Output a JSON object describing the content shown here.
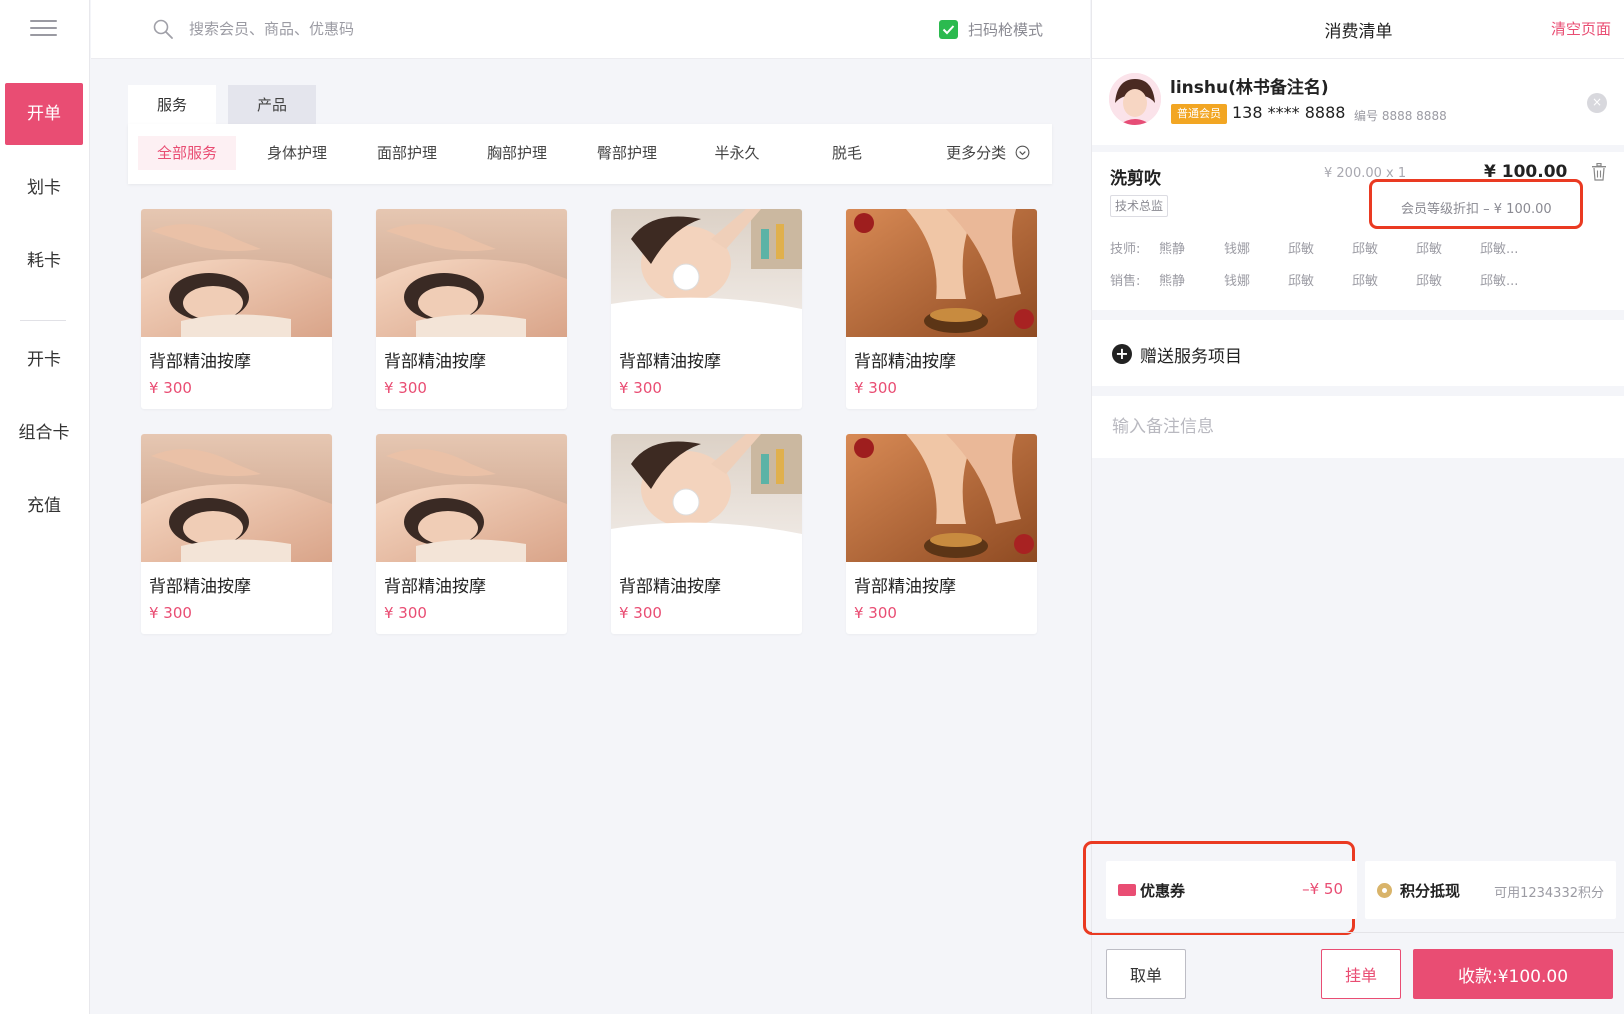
{
  "sidebar": {
    "items": [
      {
        "label": "开单",
        "active": true
      },
      {
        "label": "划卡"
      },
      {
        "label": "耗卡"
      },
      {
        "label": "开卡"
      },
      {
        "label": "组合卡"
      },
      {
        "label": "充值"
      }
    ]
  },
  "search": {
    "placeholder": "搜索会员、商品、优惠码",
    "scan_mode_label": "扫码枪模式",
    "scan_mode_checked": true
  },
  "tabs": [
    {
      "label": "服务",
      "active": true
    },
    {
      "label": "产品"
    }
  ],
  "categories": [
    {
      "label": "全部服务",
      "active": true
    },
    {
      "label": "身体护理"
    },
    {
      "label": "面部护理"
    },
    {
      "label": "胸部护理"
    },
    {
      "label": "臀部护理"
    },
    {
      "label": "半永久"
    },
    {
      "label": "脱毛"
    },
    {
      "label": "更多分类"
    }
  ],
  "products": [
    {
      "name": "背部精油按摩",
      "price": "¥ 300",
      "image": "back-massage"
    },
    {
      "name": "背部精油按摩",
      "price": "¥ 300",
      "image": "back-massage"
    },
    {
      "name": "背部精油按摩",
      "price": "¥ 300",
      "image": "facial-care"
    },
    {
      "name": "背部精油按摩",
      "price": "¥ 300",
      "image": "oil-massage"
    },
    {
      "name": "背部精油按摩",
      "price": "¥ 300",
      "image": "back-massage"
    },
    {
      "name": "背部精油按摩",
      "price": "¥ 300",
      "image": "back-massage"
    },
    {
      "name": "背部精油按摩",
      "price": "¥ 300",
      "image": "facial-care"
    },
    {
      "name": "背部精油按摩",
      "price": "¥ 300",
      "image": "oil-massage"
    }
  ],
  "panel": {
    "title": "消费清单",
    "clear_label": "清空页面",
    "member": {
      "name": "linshu(林书备注名)",
      "level": "普通会员",
      "phone": "138 **** 8888",
      "number": "编号 8888 8888",
      "close_icon": "×"
    },
    "order_item": {
      "name": "洗剪吹",
      "unit_price": "¥ 200.00 x 1",
      "total": "¥ 100.00",
      "tag": "技术总监",
      "discount": "会员等级折扣 – ¥ 100.00",
      "technician_label": "技师:",
      "sales_label": "销售:",
      "technicians": [
        "熊静",
        "钱娜",
        "邱敏",
        "邱敏",
        "邱敏",
        "邱敏..."
      ],
      "sales": [
        "熊静",
        "钱娜",
        "邱敏",
        "邱敏",
        "邱敏",
        "邱敏..."
      ]
    },
    "gift_icon": "+",
    "gift_label": "赠送服务项目",
    "note_placeholder": "输入备注信息",
    "coupon": {
      "label": "优惠券",
      "value": "–¥ 50"
    },
    "points": {
      "label": "积分抵现",
      "available": "可用1234332积分"
    },
    "buttons": {
      "cancel": "取单",
      "hang": "挂单",
      "pay": "收款:¥100.00"
    }
  },
  "colors": {
    "accent": "#e94d73",
    "badge": "#f2a623",
    "check": "#2cba4f",
    "highlight_box": "#ea3a22"
  }
}
